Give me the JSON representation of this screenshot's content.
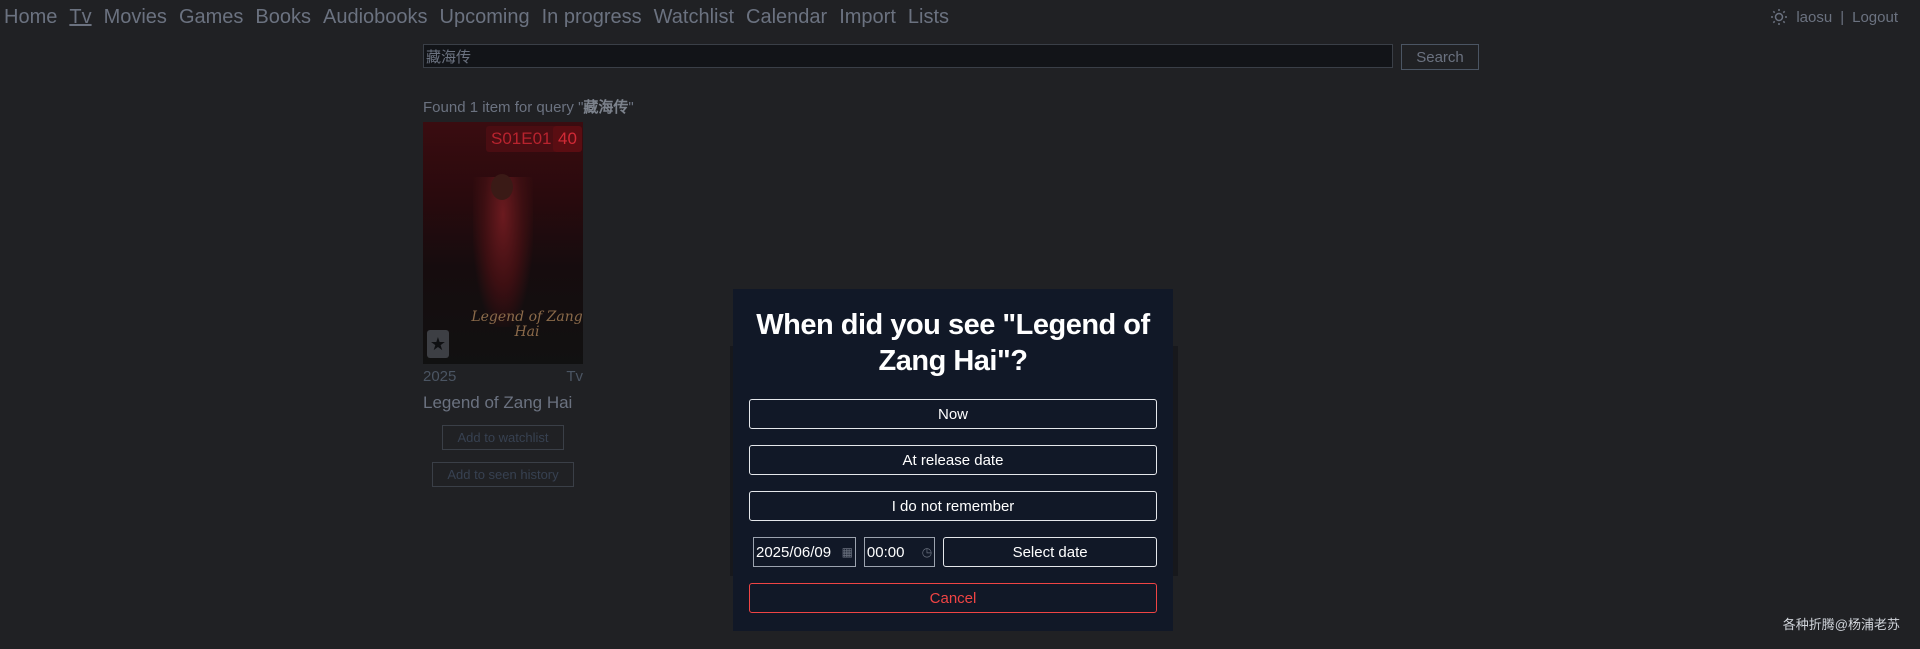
{
  "nav": {
    "items": [
      {
        "label": "Home",
        "active": false
      },
      {
        "label": "Tv",
        "active": true
      },
      {
        "label": "Movies",
        "active": false
      },
      {
        "label": "Games",
        "active": false
      },
      {
        "label": "Books",
        "active": false
      },
      {
        "label": "Audiobooks",
        "active": false
      },
      {
        "label": "Upcoming",
        "active": false
      },
      {
        "label": "In progress",
        "active": false
      },
      {
        "label": "Watchlist",
        "active": false
      },
      {
        "label": "Calendar",
        "active": false
      },
      {
        "label": "Import",
        "active": false
      },
      {
        "label": "Lists",
        "active": false
      }
    ]
  },
  "user": {
    "name": "laosu",
    "separator": "|",
    "logout": "Logout"
  },
  "search": {
    "value": "藏海传",
    "button": "Search"
  },
  "results": {
    "prefix": "Found 1 item for query \"",
    "query": "藏海传",
    "suffix": "\""
  },
  "card": {
    "episode_badge": "S01E01",
    "count_badge": "40",
    "poster_text": "Legend of Zang Hai",
    "star": "★",
    "year": "2025",
    "type": "Tv",
    "title": "Legend of Zang Hai",
    "watchlist_button": "Add to watchlist",
    "history_button": "Add to seen history"
  },
  "modal": {
    "title": "When did you see \"Legend of Zang Hai\"?",
    "now": "Now",
    "release": "At release date",
    "not_remember": "I do not remember",
    "date_value": "2025/06/09",
    "time_value": "00:00",
    "select_date": "Select date",
    "cancel": "Cancel"
  },
  "watermark": "各种折腾@杨浦老苏"
}
